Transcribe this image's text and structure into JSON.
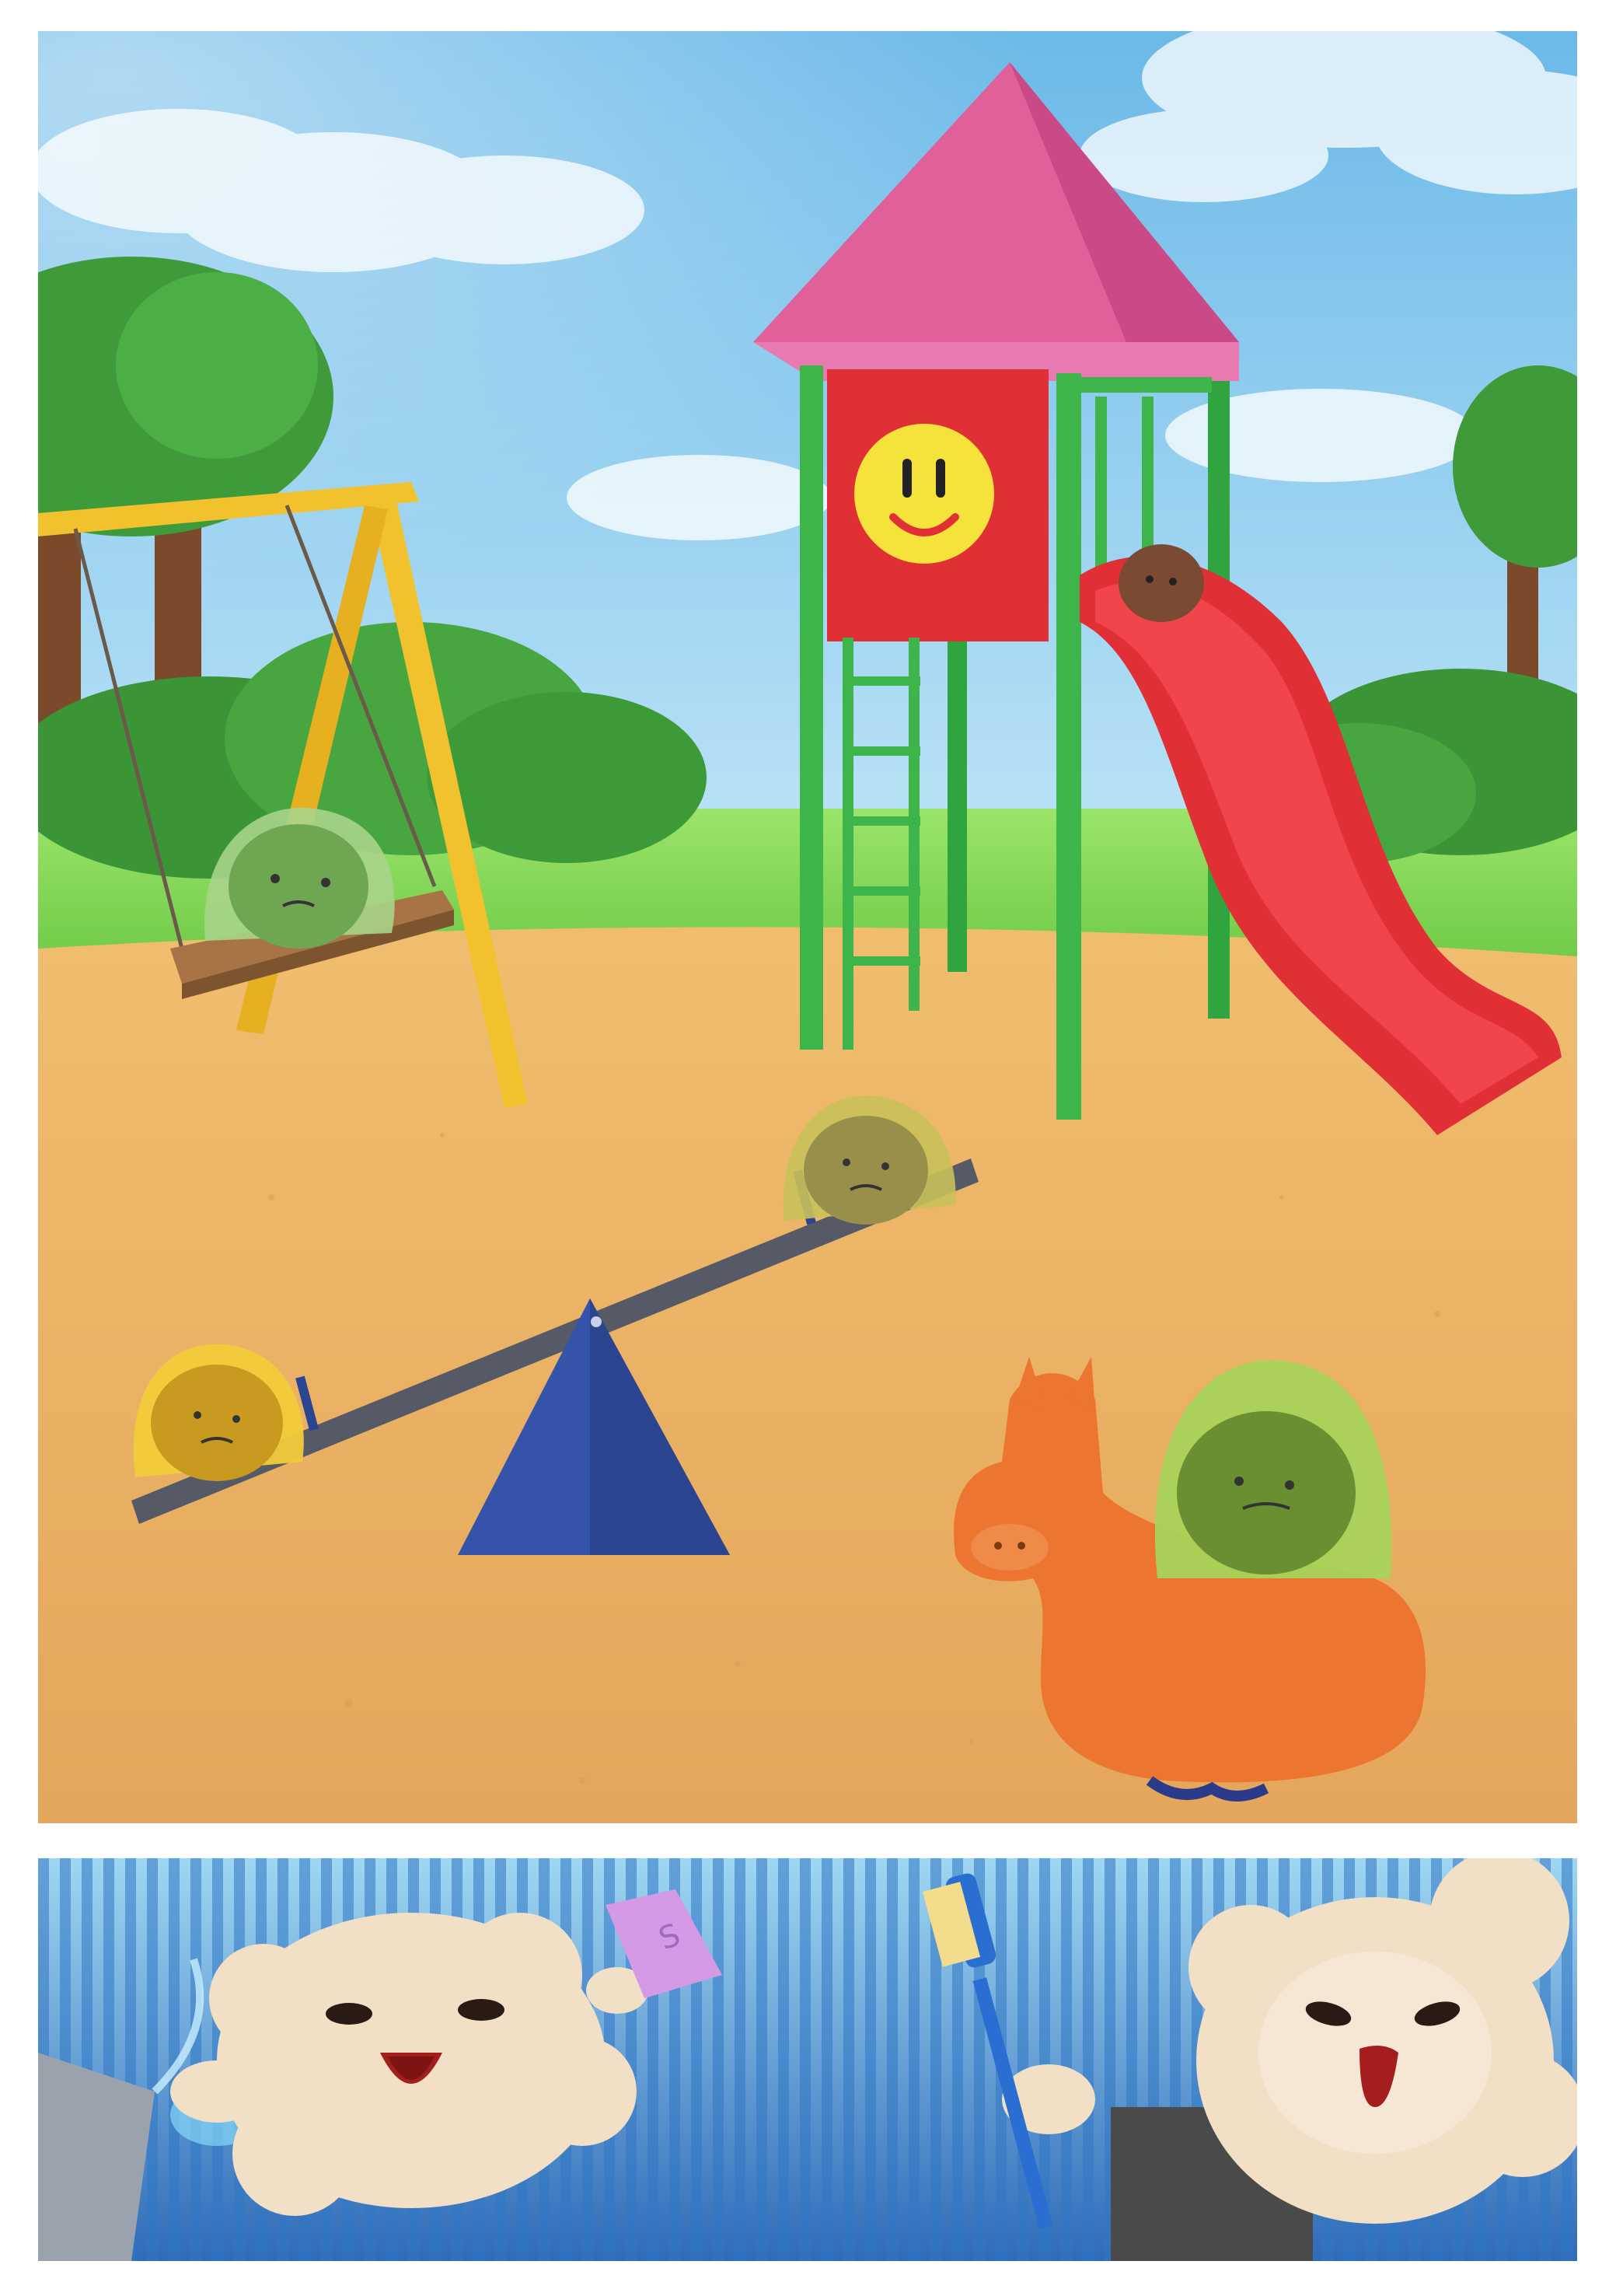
{
  "page": {
    "background_color": "#ffffff",
    "panel_count": 2
  },
  "panel_top": {
    "scene": "playground",
    "sky_color": "#8fcff0",
    "ground_color": "#e9b467",
    "roof_color": "#e0609a",
    "slide_color": "#e03035",
    "frame_color": "#3db54a",
    "swing_frame_color": "#f2c22e",
    "seesaw_base_color": "#3553a8",
    "spring_horse_color": "#ec7530",
    "smiley_badge_color": "#f5e23a"
  },
  "panel_bottom": {
    "stripe_color": "#3b8fd0",
    "sheep_wool_color": "#f1dfc6",
    "soap_color": "#d49ae6",
    "soap_text": "S",
    "brush_handle_color": "#2b6ed1"
  }
}
